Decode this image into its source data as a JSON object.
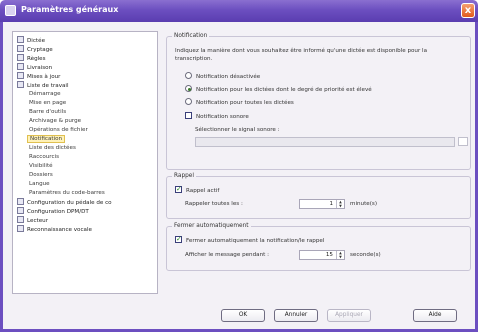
{
  "window": {
    "title": "Paramètres généraux",
    "close_glyph": "x"
  },
  "tree": {
    "items": [
      {
        "label": "Dictée",
        "icon": "document-icon"
      },
      {
        "label": "Cryptage",
        "icon": "lock-icon"
      },
      {
        "label": "Règles",
        "icon": "section-icon"
      },
      {
        "label": "Livraison",
        "icon": "delivery-icon"
      },
      {
        "label": "Mises à jour",
        "icon": "globe-icon"
      },
      {
        "label": "Liste de travail",
        "icon": "list-icon"
      },
      {
        "label": "Démarrage",
        "icon": null
      },
      {
        "label": "Mise en page",
        "icon": null
      },
      {
        "label": "Barre d'outils",
        "icon": null
      },
      {
        "label": "Archivage & purge",
        "icon": null
      },
      {
        "label": "Opérations de fichier",
        "icon": null
      },
      {
        "label": "Notification",
        "icon": null
      },
      {
        "label": "Liste des dictées",
        "icon": null
      },
      {
        "label": "Raccourcis",
        "icon": null
      },
      {
        "label": "Visibilité",
        "icon": null
      },
      {
        "label": "Dossiers",
        "icon": null
      },
      {
        "label": "Langue",
        "icon": null
      },
      {
        "label": "Paramètres du code-barres",
        "icon": null
      },
      {
        "label": "Configuration du pédale de co",
        "icon": "pedal-icon"
      },
      {
        "label": "Configuration DPM/DT",
        "icon": "device-icon"
      },
      {
        "label": "Lecteur",
        "icon": "player-icon"
      },
      {
        "label": "Reconnaissance vocale",
        "icon": "speech-icon"
      }
    ],
    "selected": "Notification"
  },
  "notification": {
    "title": "Notification",
    "description": "Indiquez la manière dont vous souhaitez être informé qu'une dictée est disponible pour la transcription.",
    "options": [
      "Notification désactivée",
      "Notification pour les dictées dont le degré de priorité est élevé",
      "Notification pour toutes les dictées"
    ],
    "selected_option": 1,
    "sonore_label": "Notification sonore",
    "sonore_checked": false,
    "select_sound_label": "Sélectionner le signal sonore :"
  },
  "rappel": {
    "title": "Rappel",
    "active_label": "Rappel actif",
    "active_checked": true,
    "interval_label": "Rappeler toutes les :",
    "interval_value": "1",
    "unit": "minute(s)"
  },
  "auto_close": {
    "title": "Fermer automatiquement",
    "check_label": "Fermer automatiquement la notification/le rappel",
    "checked": true,
    "display_label": "Afficher le message pendant :",
    "display_value": "15",
    "unit": "seconde(s)"
  },
  "buttons": {
    "ok": "OK",
    "cancel": "Annuler",
    "apply": "Appliquer",
    "help": "Aide"
  }
}
